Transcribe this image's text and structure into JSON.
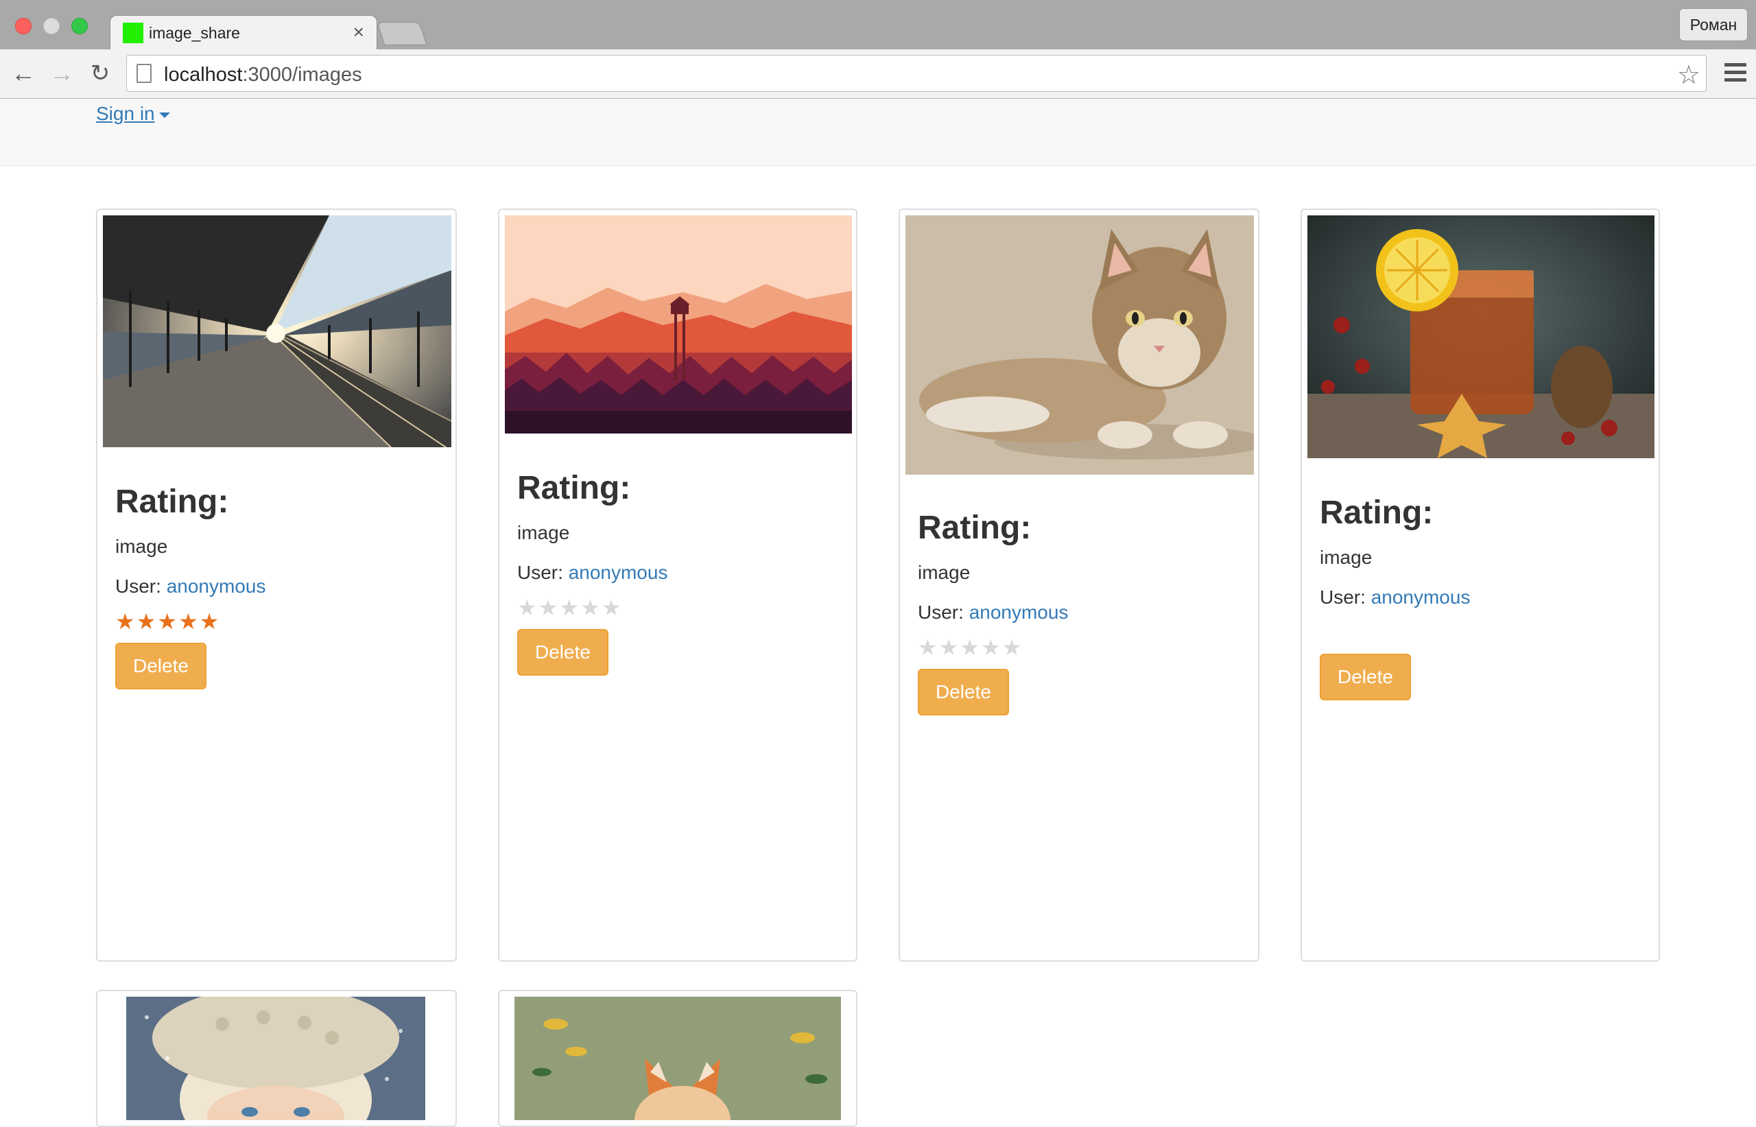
{
  "browser": {
    "tab_title": "image_share",
    "tab_close": "×",
    "profile_name": "Роман",
    "url_host": "localhost",
    "url_path": ":3000/images",
    "back_glyph": "←",
    "forward_glyph": "→",
    "reload_glyph": "↻",
    "bookmark_glyph": "☆"
  },
  "navbar": {
    "signin_label": "Sign in"
  },
  "cards": [
    {
      "rating_label": "Rating:",
      "description": "image",
      "user_prefix": "User: ",
      "user_name": "anonymous",
      "stars_filled": "★★★★★",
      "stars_empty": "",
      "delete_label": "Delete",
      "image_subject": "railway-station-tunnel"
    },
    {
      "rating_label": "Rating:",
      "description": "image",
      "user_prefix": "User: ",
      "user_name": "anonymous",
      "stars_filled": "",
      "stars_empty": "★★★★★",
      "delete_label": "Delete",
      "image_subject": "firewatch-forest-tower"
    },
    {
      "rating_label": "Rating:",
      "description": "image",
      "user_prefix": "User: ",
      "user_name": "anonymous",
      "stars_filled": "",
      "stars_empty": "★★★★★",
      "delete_label": "Delete",
      "image_subject": "tabby-kitten-drawing"
    },
    {
      "rating_label": "Rating:",
      "description": "image",
      "user_prefix": "User: ",
      "user_name": "anonymous",
      "stars_filled": "",
      "stars_empty": "",
      "delete_label": "Delete",
      "image_subject": "tea-glass-still-life"
    },
    {
      "image_subject": "girl-knit-hat-painting"
    },
    {
      "image_subject": "fox-autumn-painting"
    }
  ],
  "colors": {
    "link": "#337ab7",
    "warning_button": "#f0ad4e",
    "star_filled": "#e8711c",
    "star_empty": "#d8d8d8"
  }
}
